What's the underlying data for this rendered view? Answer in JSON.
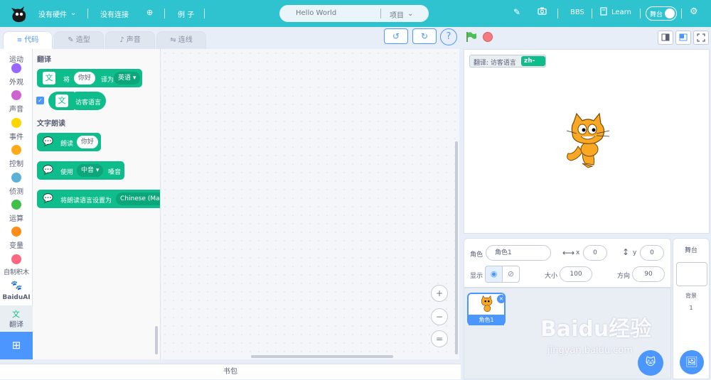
{
  "topbar": {
    "hardware": "没有硬件",
    "connection": "没有连接",
    "examples": "例 子",
    "project_name": "Hello World",
    "project_menu": "项目",
    "bbs": "BBS",
    "learn": "Learn",
    "stage_toggle": "舞台"
  },
  "tabs": [
    {
      "label": "代码"
    },
    {
      "label": "造型"
    },
    {
      "label": "声音"
    },
    {
      "label": "连线"
    }
  ],
  "categories": [
    {
      "label": "运动",
      "color": "#4c97ff"
    },
    {
      "label": "外观",
      "color": "#9966ff"
    },
    {
      "label": "声音",
      "color": "#cf63cf"
    },
    {
      "label": "事件",
      "color": "#ffd500"
    },
    {
      "label": "控制",
      "color": "#ffab19"
    },
    {
      "label": "侦测",
      "color": "#5cb1d6"
    },
    {
      "label": "运算",
      "color": "#40bf4a"
    },
    {
      "label": "变量",
      "color": "#ff8c1a"
    },
    {
      "label": "自制积木",
      "color": "#ff6680"
    },
    {
      "label": "BaiduAI",
      "color": "#2932e1"
    },
    {
      "label": "翻译",
      "color": "#0fbd8c"
    }
  ],
  "palette": {
    "translate_header": "翻译",
    "block_translate": {
      "prefix": "将",
      "text": "你好",
      "mid": "译为",
      "lang": "英语"
    },
    "block_visitor_lang": "访客语言",
    "tts_header": "文字朗读",
    "block_speak": {
      "prefix": "朗读",
      "text": "你好"
    },
    "block_voice": {
      "prefix": "使用",
      "voice": "中音",
      "suffix": "嗓音"
    },
    "block_set_lang": {
      "prefix": "将朗读语言设置为",
      "lang": "Chinese (Man"
    }
  },
  "zoom": {
    "in": "+",
    "out": "−",
    "reset": "="
  },
  "bag_label": "书包",
  "stage": {
    "monitor_label": "翻译: 访客语言",
    "monitor_value": "zh-cn"
  },
  "sprite_info": {
    "sprite_label": "角色",
    "sprite_name": "角色1",
    "x_label": "x",
    "x_value": "0",
    "y_label": "y",
    "y_value": "0",
    "show_label": "显示",
    "size_label": "大小",
    "size_value": "100",
    "direction_label": "方向",
    "direction_value": "90"
  },
  "sprite_list": [
    {
      "name": "角色1"
    }
  ],
  "stage_panel": {
    "title": "舞台",
    "backdrops_label": "背景",
    "backdrops_count": "1"
  },
  "watermark": {
    "brand": "Baidu经验",
    "url": "jingyan.baidu.com"
  }
}
